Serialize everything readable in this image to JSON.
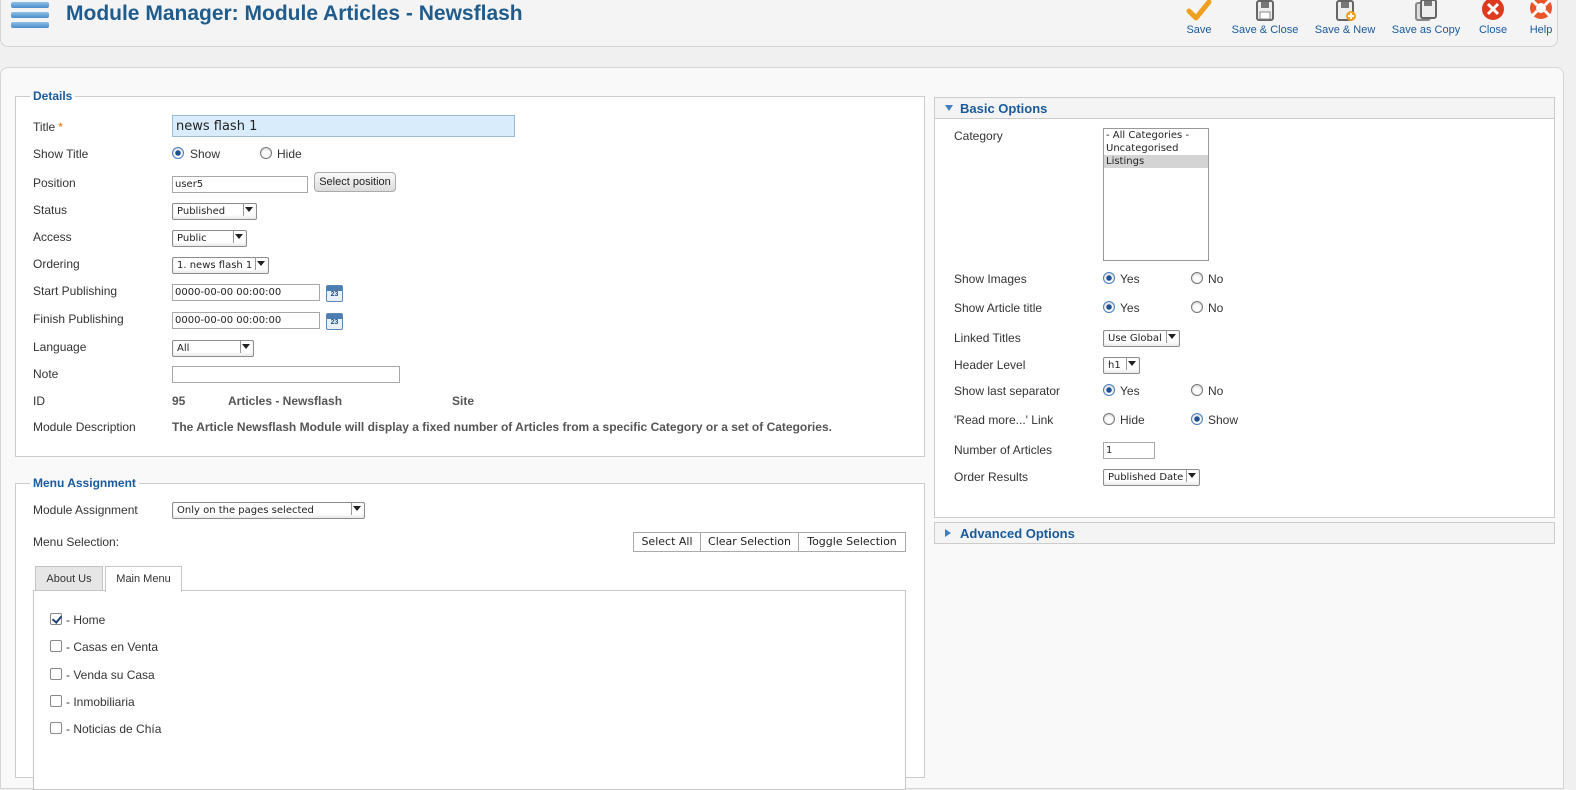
{
  "header": {
    "title": "Module Manager: Module Articles - Newsflash",
    "toolbar": [
      {
        "id": "save",
        "label": "Save",
        "icon": "checkmark-icon"
      },
      {
        "id": "save-close",
        "label": "Save & Close",
        "icon": "save-icon"
      },
      {
        "id": "save-new",
        "label": "Save & New",
        "icon": "save-new-icon"
      },
      {
        "id": "save-copy",
        "label": "Save as Copy",
        "icon": "save-copy-icon"
      },
      {
        "id": "close",
        "label": "Close",
        "icon": "close-icon"
      },
      {
        "id": "help",
        "label": "Help",
        "icon": "help-icon"
      }
    ]
  },
  "details": {
    "legend": "Details",
    "title_label": "Title",
    "required_mark": "*",
    "title_value": "news flash 1",
    "show_title_label": "Show Title",
    "show_title_options": [
      "Show",
      "Hide"
    ],
    "show_title_selected": "Show",
    "position_label": "Position",
    "position_value": "user5",
    "select_position_label": "Select position",
    "status_label": "Status",
    "status_value": "Published",
    "access_label": "Access",
    "access_value": "Public",
    "ordering_label": "Ordering",
    "ordering_value": "1. news flash 1",
    "start_publishing_label": "Start Publishing",
    "start_publishing_value": "0000-00-00 00:00:00",
    "finish_publishing_label": "Finish Publishing",
    "finish_publishing_value": "0000-00-00 00:00:00",
    "calendar_day": "23",
    "language_label": "Language",
    "language_value": "All",
    "note_label": "Note",
    "note_value": "",
    "id_label": "ID",
    "id_value": "95",
    "module_type": "Articles - Newsflash",
    "client": "Site",
    "module_description_label": "Module Description",
    "module_description": "The Article Newsflash Module will display a fixed number of Articles from a specific Category or a set of Categories."
  },
  "menu_assignment": {
    "legend": "Menu Assignment",
    "module_assignment_label": "Module Assignment",
    "module_assignment_value": "Only on the pages selected",
    "menu_selection_label": "Menu Selection:",
    "select_all_label": "Select All",
    "clear_selection_label": "Clear Selection",
    "toggle_selection_label": "Toggle Selection",
    "tabs": [
      "About Us",
      "Main Menu"
    ],
    "active_tab": "Main Menu",
    "items": [
      {
        "label": "- Home",
        "checked": true
      },
      {
        "label": "- Casas en Venta",
        "checked": false
      },
      {
        "label": "- Venda su Casa",
        "checked": false
      },
      {
        "label": "- Inmobiliaria",
        "checked": false
      },
      {
        "label": "- Noticias de Chía",
        "checked": false
      }
    ]
  },
  "basic_options": {
    "title": "Basic Options",
    "category_label": "Category",
    "category_options": [
      "- All Categories -",
      "Uncategorised",
      "Listings"
    ],
    "category_selected": "Listings",
    "show_images_label": "Show Images",
    "show_article_title_label": "Show Article title",
    "linked_titles_label": "Linked Titles",
    "linked_titles_value": "Use Global",
    "header_level_label": "Header Level",
    "header_level_value": "h1",
    "show_last_separator_label": "Show last separator",
    "read_more_label": "'Read more...' Link",
    "number_of_articles_label": "Number of Articles",
    "number_of_articles_value": "1",
    "order_results_label": "Order Results",
    "order_results_value": "Published Date",
    "yes_label": "Yes",
    "no_label": "No",
    "hide_label": "Hide",
    "show_label": "Show"
  },
  "advanced_options": {
    "title": "Advanced Options"
  },
  "colors": {
    "title_blue": "#1f5c8c",
    "link_blue": "#1a5a9c",
    "required_orange": "#e56a00",
    "close_red": "#e03a1e"
  }
}
